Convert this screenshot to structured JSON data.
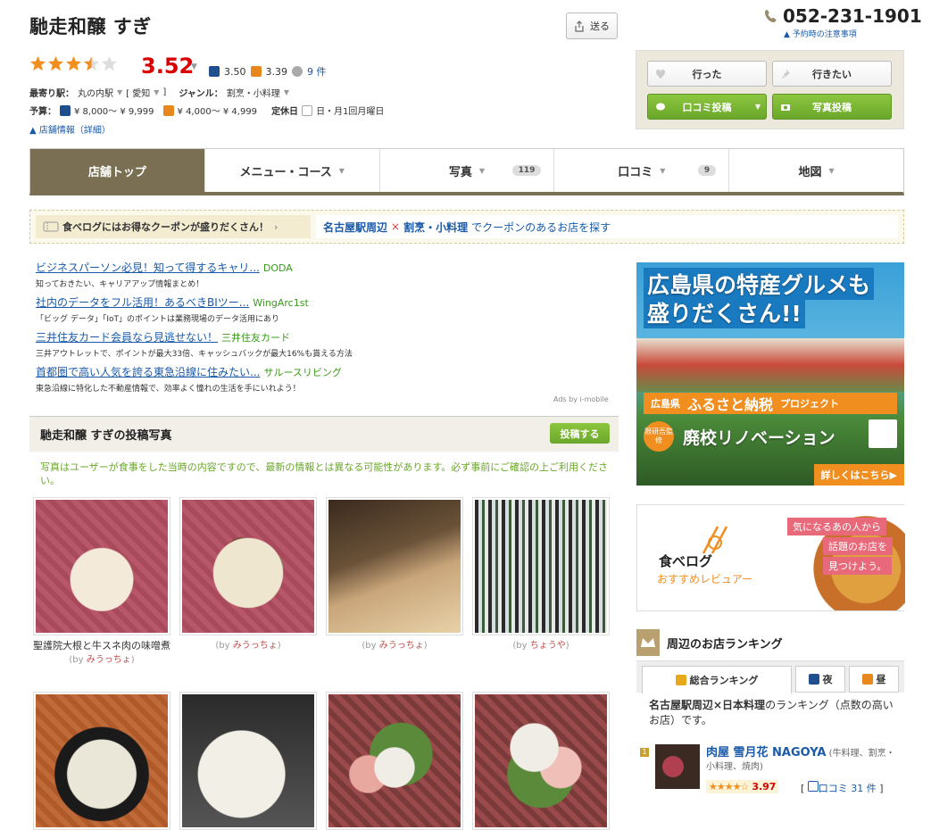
{
  "shop": {
    "name": "馳走和醸 すぎ",
    "share_label": "送る",
    "phone": "052-231-1901",
    "reserve_note": "予約時の注意事項",
    "rating": "3.52",
    "night_score": "3.50",
    "lunch_score": "3.39",
    "review_count": "9 件",
    "stars_value": 3.5
  },
  "info": {
    "station_label": "最寄り駅：",
    "station": "丸の内駅",
    "pref": "[ 愛知",
    "pref_close": "]",
    "genre_label": "ジャンル：",
    "genre": "割烹・小料理",
    "budget_label": "予算：",
    "budget_night": "¥ 8,000～ ¥ 9,999",
    "budget_lunch": "¥ 4,000～ ¥ 4,999",
    "holiday_label": "定休日",
    "holiday": "日・月1回月曜日",
    "detail_link": "店舗情報（詳細）"
  },
  "actions": {
    "went": "行った",
    "want": "行きたい",
    "review_post": "口コミ投稿",
    "photo_post": "写真投稿"
  },
  "tabs": [
    {
      "label": "店舗トップ"
    },
    {
      "label": "メニュー・コース"
    },
    {
      "label": "写真",
      "count": "119"
    },
    {
      "label": "口コミ",
      "count": "9"
    },
    {
      "label": "地図"
    }
  ],
  "coupon": {
    "left": "食べログにはお得なクーポンが盛りだくさん！",
    "area": "名古屋駅周辺",
    "cross": "×",
    "genre": "割烹・小料理",
    "suffix": "でクーポンのあるお店を探す"
  },
  "ads": [
    {
      "title": "ビジネスパーソン必見！知って得するキャリ...",
      "source": "DODA",
      "desc": "知っておきたい、キャリアアップ情報まとめ！"
    },
    {
      "title": "社内のデータをフル活用！あるべきBIツー...",
      "source": "WingArc1st",
      "desc": "「ビッグ データ」「IoT」のポイントは業務現場のデータ活用にあり"
    },
    {
      "title": "三井住友カード会員なら見逃せない！",
      "source": "三井住友カード",
      "desc": "三井アウトレットで、ポイントが最大33倍、キャッシュバックが最大16%も貰える方法"
    },
    {
      "title": "首都圏で高い人気を誇る東急沿線に住みたい...",
      "source": "サルースリビング",
      "desc": "東急沿線に特化した不動産情報で、効率よく憧れの生活を手にいれよう！"
    }
  ],
  "ads_by": "Ads by i-mobile",
  "photos": {
    "heading": "馳走和醸 すぎの投稿写真",
    "post_button": "投稿する",
    "notice": "写真はユーザーが食事をした当時の内容ですので、最新の情報とは異なる可能性があります。必ず事前にご確認の上ご利用ください。",
    "items": [
      {
        "caption": "聖護院大根と牛スネ肉の味噌煮",
        "by": "(by",
        "user": "みうっちょ",
        "close": ")"
      },
      {
        "caption": "",
        "by": "(by",
        "user": "みうっちょ",
        "close": ")"
      },
      {
        "caption": "",
        "by": "(by",
        "user": "みうっちょ",
        "close": ")"
      },
      {
        "caption": "",
        "by": "(by",
        "user": "ちょうや",
        "close": ")"
      }
    ]
  },
  "banner1": {
    "line1": "広島県の特産グルメも",
    "line2": "盛りだくさん!!",
    "pref": "広島県",
    "project": "ふるさと納税",
    "project_suffix": "プロジェクト",
    "supervise": "限研吾監修",
    "renovation": "廃校リノベーション",
    "more": "詳しくはこちら▶"
  },
  "banner2": {
    "logo": "食べログ",
    "sub": "おすすめレビュアー",
    "line1": "気になるあの人から",
    "line2": "話題のお店を",
    "line3": "見つけよう。"
  },
  "ranking": {
    "heading": "周辺のお店ランキング",
    "tab_all": "総合ランキング",
    "tab_night": "夜",
    "tab_lunch": "昼",
    "desc_area": "名古屋駅周辺×日本料理",
    "desc_rest": "のランキング（点数の高いお店）です。",
    "item_rank": "1",
    "item_name": "肉屋 雪月花 NAGOYA",
    "item_genre": "(牛料理、割烹・小料理、焼肉)",
    "item_score": "3.97",
    "item_reviews_label": "口コミ",
    "item_reviews": "31 件"
  },
  "colors": {
    "brand": "#7a6f52",
    "rating_red": "#d80000",
    "link_blue": "#1a5aa8",
    "green": "#6aa72a"
  }
}
